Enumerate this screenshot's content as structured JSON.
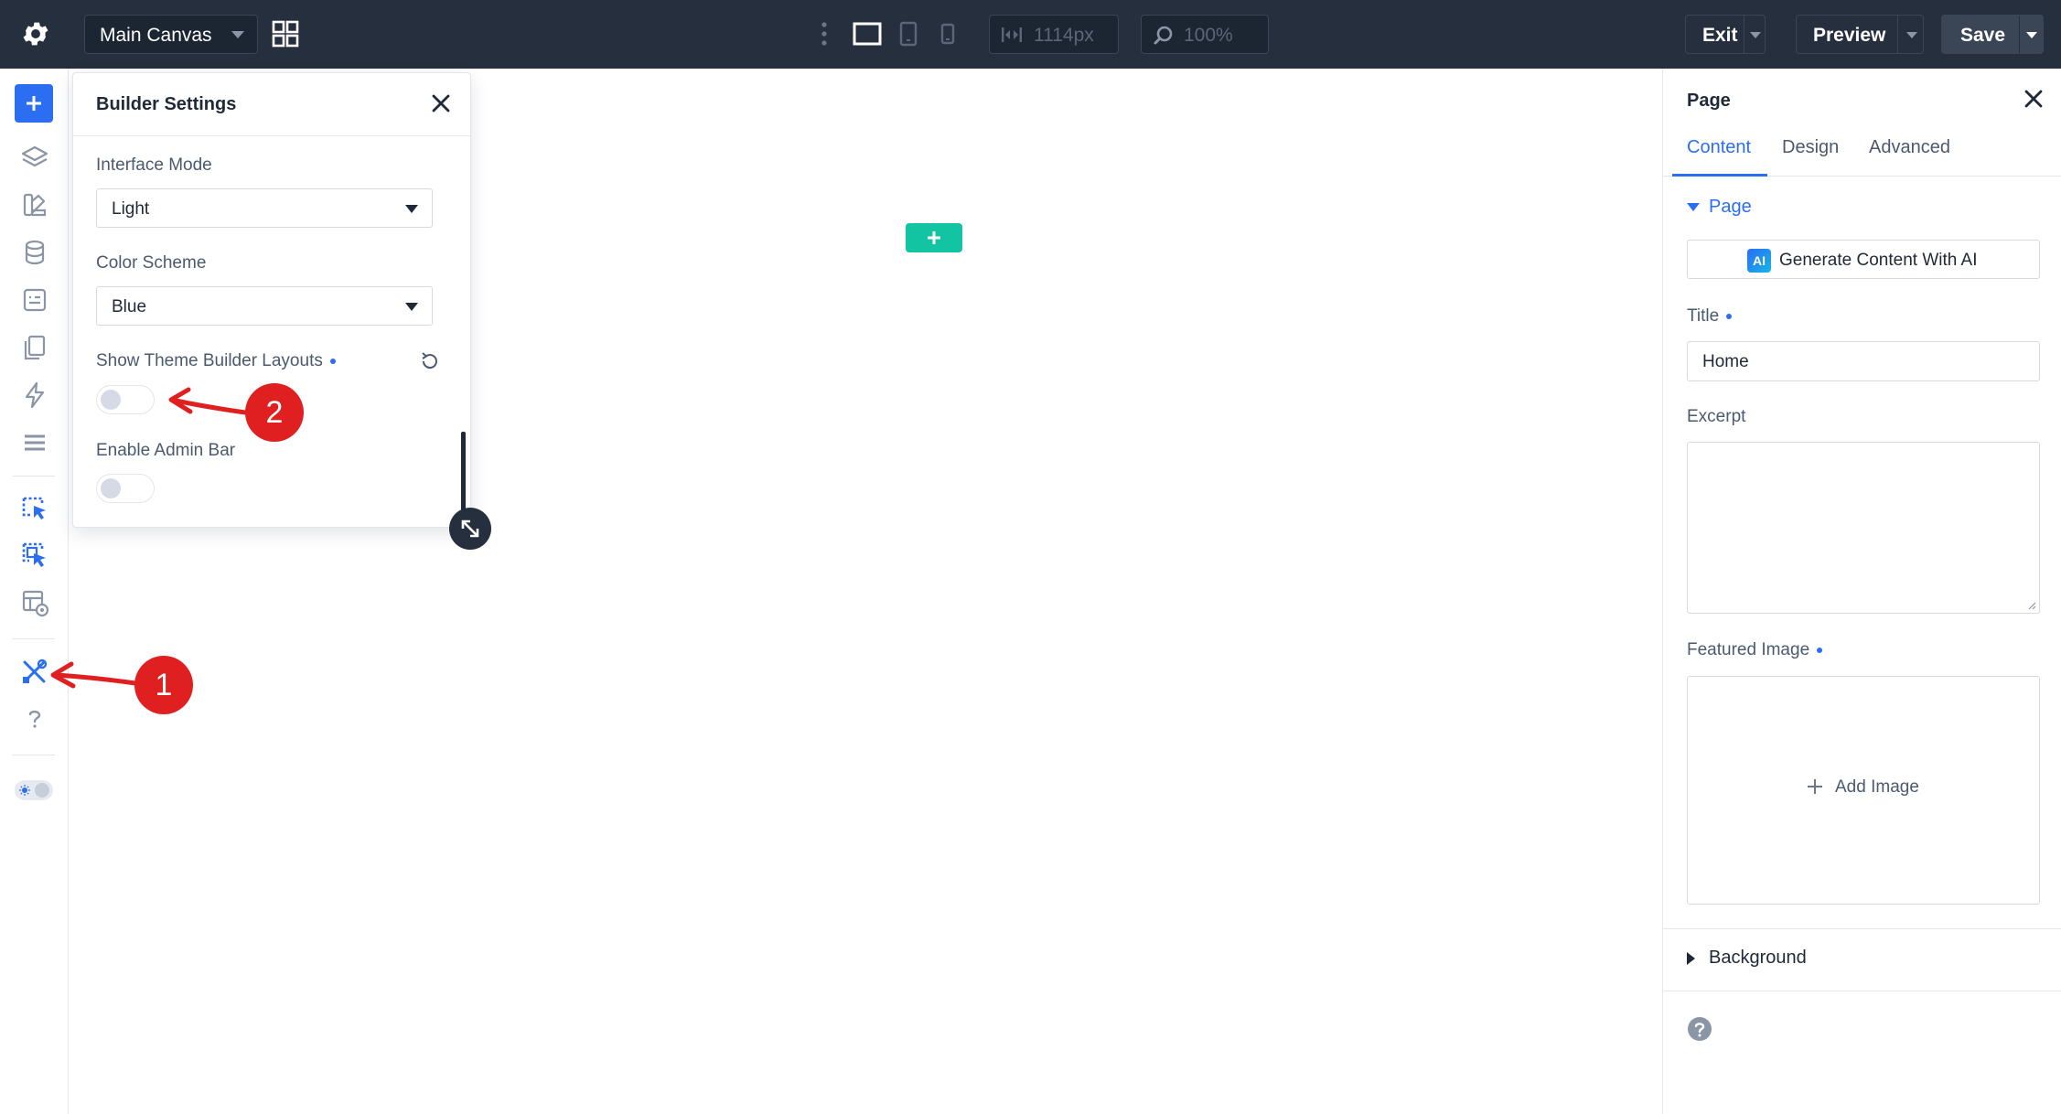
{
  "topbar": {
    "canvas_label": "Main Canvas",
    "width_value": "1114px",
    "zoom_value": "100%",
    "exit_label": "Exit",
    "preview_label": "Preview",
    "save_label": "Save"
  },
  "builder_settings": {
    "title": "Builder Settings",
    "interface_mode_label": "Interface Mode",
    "interface_mode_value": "Light",
    "color_scheme_label": "Color Scheme",
    "color_scheme_value": "Blue",
    "theme_builder_label": "Show Theme Builder Layouts",
    "theme_builder_enabled": false,
    "admin_bar_label": "Enable Admin Bar",
    "admin_bar_enabled": false
  },
  "settings_panel": {
    "title": "Page",
    "tabs": [
      {
        "label": "Content",
        "active": true
      },
      {
        "label": "Design",
        "active": false
      },
      {
        "label": "Advanced",
        "active": false
      }
    ],
    "group_label": "Page",
    "ai_button_badge": "AI",
    "ai_button_label": "Generate Content With AI",
    "title_label": "Title",
    "title_value": "Home",
    "excerpt_label": "Excerpt",
    "featured_image_label": "Featured Image",
    "add_image_label": "Add Image",
    "background_label": "Background"
  },
  "annotations": {
    "callout_1": "1",
    "callout_2": "2"
  },
  "colors": {
    "topbar": "#252f3e",
    "accent": "#2b6ef2",
    "add_section": "#13c4a3",
    "callout": "#e02020"
  }
}
